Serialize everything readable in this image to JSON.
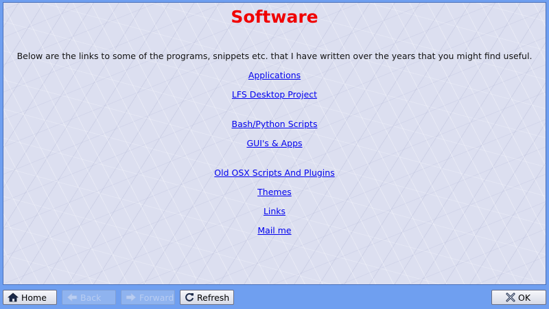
{
  "page": {
    "title": "Software",
    "intro": "Below are the links to some of the programs, snippets etc. that I have written over the years that you might find useful."
  },
  "links": [
    {
      "label": "Applications"
    },
    {
      "label": "LFS Desktop Project"
    },
    {
      "label": "Bash/Python Scripts"
    },
    {
      "label": "GUI's & Apps"
    },
    {
      "label": "Old OSX Scripts And Plugins"
    },
    {
      "label": "Themes"
    },
    {
      "label": "Links"
    },
    {
      "label": "Mail me"
    }
  ],
  "toolbar": {
    "home_label": "Home",
    "back_label": "Back",
    "forward_label": "Forward",
    "refresh_label": "Refresh",
    "ok_label": "OK"
  },
  "icons": {
    "home": "home-icon",
    "back": "back-arrow-icon",
    "forward": "forward-arrow-icon",
    "refresh": "refresh-icon",
    "ok": "close-x-icon"
  },
  "colors": {
    "title": "#f00000",
    "link": "#0000ee",
    "frame": "#6f9ff0"
  }
}
